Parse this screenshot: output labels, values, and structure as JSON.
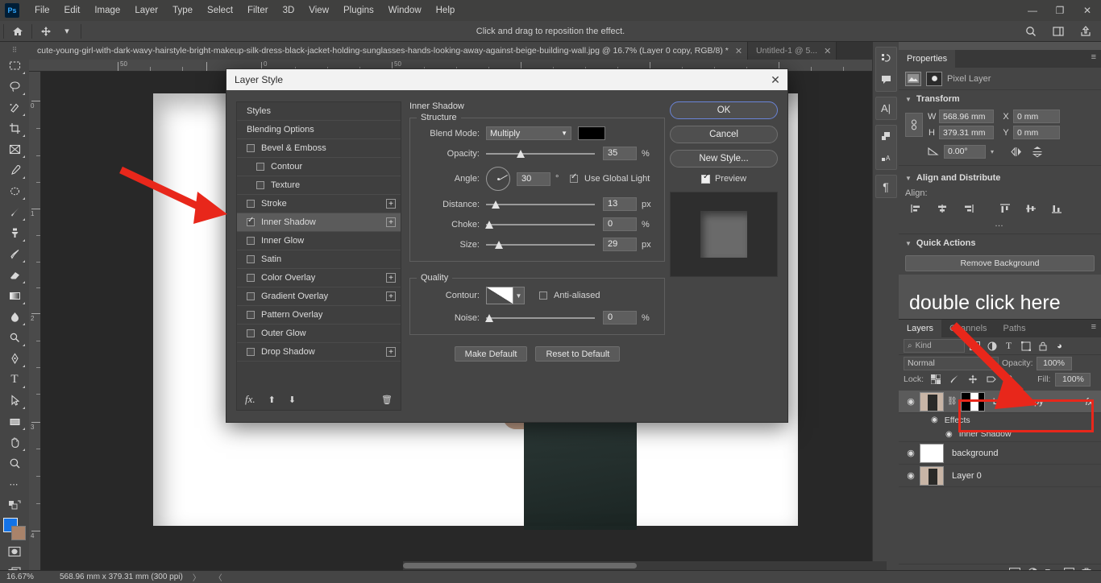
{
  "app": {
    "logo": "Ps"
  },
  "menubar": {
    "items": [
      "File",
      "Edit",
      "Image",
      "Layer",
      "Type",
      "Select",
      "Filter",
      "3D",
      "View",
      "Plugins",
      "Window",
      "Help"
    ],
    "window_controls": [
      "—",
      "❐",
      "✕"
    ]
  },
  "optionsbar": {
    "home_icon": "home-icon",
    "tool_icon": "move-tool-icon",
    "hint": "Click and drag to reposition the effect.",
    "right_icons": [
      "search-icon",
      "workspace-icon",
      "share-icon"
    ]
  },
  "tabs": [
    {
      "label": "cute-young-girl-with-dark-wavy-hairstyle-bright-makeup-silk-dress-black-jacket-holding-sunglasses-hands-looking-away-against-beige-building-wall.jpg @ 16.7% (Layer 0 copy, RGB/8) *",
      "close": "✕",
      "active": true
    },
    {
      "label": "Untitled-1 @ 5...",
      "close": "✕",
      "active": false
    }
  ],
  "toolbar": {
    "tools": [
      {
        "name": "marquee-tool",
        "glyph": "▭"
      },
      {
        "name": "lasso-tool",
        "glyph": "◯"
      },
      {
        "name": "quick-selection-tool",
        "glyph": "✎"
      },
      {
        "name": "crop-tool",
        "glyph": "⌗"
      },
      {
        "name": "frame-tool",
        "glyph": "⊠"
      },
      {
        "name": "eyedropper-tool",
        "glyph": "✒"
      },
      {
        "name": "spot-healing-tool",
        "glyph": "◍"
      },
      {
        "name": "brush-tool",
        "glyph": "🖌"
      },
      {
        "name": "clone-stamp-tool",
        "glyph": "⚱"
      },
      {
        "name": "history-brush-tool",
        "glyph": "❧"
      },
      {
        "name": "eraser-tool",
        "glyph": "◣"
      },
      {
        "name": "gradient-tool",
        "glyph": "▣"
      },
      {
        "name": "blur-tool",
        "glyph": "◗"
      },
      {
        "name": "dodge-tool",
        "glyph": "◔"
      },
      {
        "name": "pen-tool",
        "glyph": "✐"
      },
      {
        "name": "type-tool",
        "glyph": "T"
      },
      {
        "name": "path-selection-tool",
        "glyph": "↖"
      },
      {
        "name": "rectangle-tool",
        "glyph": "▬"
      },
      {
        "name": "hand-tool",
        "glyph": "✋"
      },
      {
        "name": "zoom-tool",
        "glyph": "⌕"
      },
      {
        "name": "edit-toolbar",
        "glyph": "⋯"
      },
      {
        "name": "default-colors",
        "glyph": "⧉"
      }
    ],
    "foreground_color": "#1473e6",
    "background_color": "#a9836a",
    "quickmask_icon": "quick-mask-icon",
    "screenmode_icon": "screen-mode-icon"
  },
  "rulers": {
    "h_labels": [
      "50",
      "0",
      "50"
    ],
    "v_labels": [
      "0",
      "1",
      "2",
      "3",
      "4"
    ]
  },
  "statusbar": {
    "zoom": "16.67%",
    "dimensions": "568.96 mm x 379.31 mm (300 ppi)",
    "arrows": "〉 〈"
  },
  "rail": {
    "icons": [
      {
        "name": "history-icon",
        "glyph": "↻"
      },
      {
        "name": "comments-icon",
        "glyph": "🗨"
      },
      {
        "name": "character-icon",
        "glyph": "A|"
      },
      {
        "name": "libraries-icon",
        "glyph": "❏"
      },
      {
        "name": "glyphs-icon",
        "glyph": "A"
      },
      {
        "name": "paragraph-icon",
        "glyph": "¶"
      }
    ]
  },
  "properties": {
    "tab_label": "Properties",
    "menu_icon": "panel-menu-icon",
    "layer_type": "Pixel Layer",
    "type_icons": [
      "image-thumbnail-icon",
      "mask-thumbnail-icon"
    ],
    "transform": {
      "title": "Transform",
      "link_icon": "link-dimensions-icon",
      "w_label": "W",
      "w_value": "568.96 mm",
      "h_label": "H",
      "h_value": "379.31 mm",
      "x_label": "X",
      "x_value": "0 mm",
      "y_label": "Y",
      "y_value": "0 mm",
      "angle_value": "0.00°",
      "flip_h_icon": "flip-horizontal-icon",
      "flip_v_icon": "flip-vertical-icon"
    },
    "align": {
      "title": "Align and Distribute",
      "label": "Align:",
      "icons": [
        "align-left-icon",
        "align-center-h-icon",
        "align-right-icon",
        "align-top-icon",
        "align-middle-v-icon",
        "align-bottom-icon"
      ],
      "more": "…"
    },
    "quick_actions": {
      "title": "Quick Actions",
      "remove_background": "Remove Background"
    }
  },
  "layers": {
    "tabs": [
      "Layers",
      "Channels",
      "Paths"
    ],
    "active_tab": "Layers",
    "menu_icon": "panel-menu-icon",
    "filter": {
      "kind_label": "Kind",
      "search_icon": "search-icon",
      "type_icons": [
        "pixel-filter-icon",
        "adjustment-filter-icon",
        "type-filter-icon",
        "shape-filter-icon",
        "smart-filter-icon"
      ],
      "toggle_icon": "filter-toggle-icon"
    },
    "blend_mode": "Normal",
    "opacity_label": "Opacity:",
    "opacity_value": "100%",
    "lock_label": "Lock:",
    "lock_icons": [
      "lock-transparency-icon",
      "lock-image-icon",
      "lock-position-icon",
      "lock-artboard-icon",
      "lock-all-icon"
    ],
    "fill_label": "Fill:",
    "fill_value": "100%",
    "rows": [
      {
        "name": "Layer 0 copy",
        "selected": true,
        "fx": "fx",
        "eye": "◉",
        "has_mask": true
      },
      {
        "name": "Effects",
        "sub": true,
        "eye": "◉"
      },
      {
        "name": "Inner Shadow",
        "sub2": true,
        "eye": "◉"
      },
      {
        "name": "background",
        "eye": "◉",
        "white_thumb": true
      },
      {
        "name": "Layer 0",
        "eye": "◉"
      }
    ],
    "bottom_icons": [
      "link-layers-icon",
      "add-fx-icon",
      "add-mask-icon",
      "adjustment-layer-icon",
      "new-group-icon",
      "new-layer-icon",
      "delete-layer-icon"
    ]
  },
  "dialog": {
    "title": "Layer Style",
    "close": "✕",
    "styles_list": [
      {
        "label": "Styles",
        "type": "header"
      },
      {
        "label": "Blending Options",
        "type": "header"
      },
      {
        "label": "Bevel & Emboss",
        "checkbox": false
      },
      {
        "label": "Contour",
        "checkbox": false,
        "indent": true
      },
      {
        "label": "Texture",
        "checkbox": false,
        "indent": true
      },
      {
        "label": "Stroke",
        "checkbox": false,
        "plus": "+"
      },
      {
        "label": "Inner Shadow",
        "checkbox": true,
        "plus": "+",
        "selected": true
      },
      {
        "label": "Inner Glow",
        "checkbox": false
      },
      {
        "label": "Satin",
        "checkbox": false
      },
      {
        "label": "Color Overlay",
        "checkbox": false,
        "plus": "+"
      },
      {
        "label": "Gradient Overlay",
        "checkbox": false,
        "plus": "+"
      },
      {
        "label": "Pattern Overlay",
        "checkbox": false
      },
      {
        "label": "Outer Glow",
        "checkbox": false
      },
      {
        "label": "Drop Shadow",
        "checkbox": false,
        "plus": "+"
      }
    ],
    "styles_footer": {
      "fx_icon": "fx-icon",
      "up_icon": "move-up-icon",
      "down_icon": "move-down-icon",
      "delete_icon": "delete-icon"
    },
    "section_title": "Inner Shadow",
    "structure": {
      "title": "Structure",
      "blend_mode_label": "Blend Mode:",
      "blend_mode_value": "Multiply",
      "shadow_color": "#000000",
      "opacity_label": "Opacity:",
      "opacity_value": "35",
      "opacity_unit": "%",
      "angle_label": "Angle:",
      "angle_value": "30",
      "angle_unit": "°",
      "use_global_light": "Use Global Light",
      "distance_label": "Distance:",
      "distance_value": "13",
      "distance_unit": "px",
      "choke_label": "Choke:",
      "choke_value": "0",
      "choke_unit": "%",
      "size_label": "Size:",
      "size_value": "29",
      "size_unit": "px"
    },
    "quality": {
      "title": "Quality",
      "contour_label": "Contour:",
      "anti_aliased": "Anti-aliased",
      "noise_label": "Noise:",
      "noise_value": "0",
      "noise_unit": "%"
    },
    "default_buttons": [
      "Make Default",
      "Reset to Default"
    ],
    "buttons": {
      "ok": "OK",
      "cancel": "Cancel",
      "new_style": "New Style...",
      "preview": "Preview"
    }
  },
  "annotations": {
    "text": "double click here",
    "color": "#e8271b",
    "arrow_left_name": "arrow-pointing-to-inner-shadow",
    "arrow_right_name": "arrow-pointing-to-layer-row",
    "box_name": "highlight-box-layer-row"
  }
}
